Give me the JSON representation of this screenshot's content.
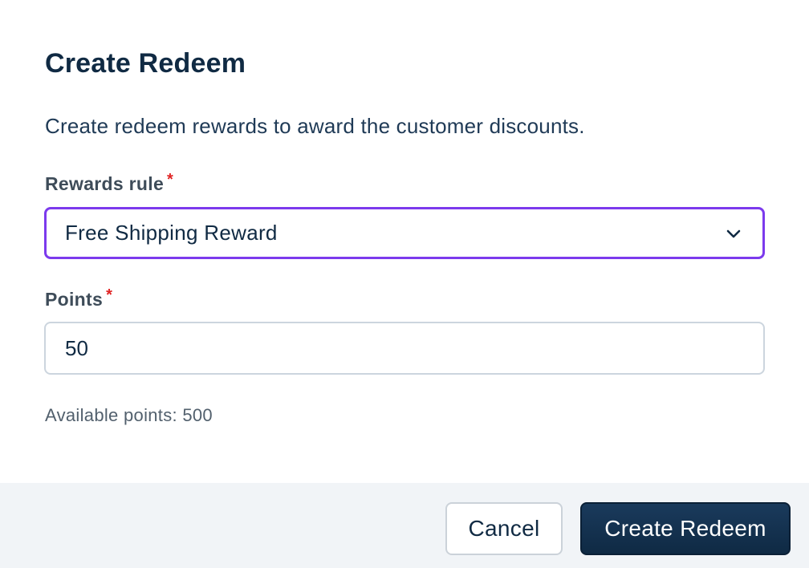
{
  "dialog": {
    "title": "Create Redeem",
    "description": "Create redeem rewards to award the customer discounts."
  },
  "form": {
    "rewards_rule": {
      "label": "Rewards rule",
      "required_mark": "*",
      "selected_value": "Free Shipping Reward"
    },
    "points": {
      "label": "Points",
      "required_mark": "*",
      "value": "50"
    },
    "available_points_text": "Available points: 500"
  },
  "footer": {
    "cancel_label": "Cancel",
    "submit_label": "Create Redeem"
  },
  "colors": {
    "focus_border": "#7c3aed",
    "primary_button": "#132f4c",
    "required": "#e02424",
    "footer_bg": "#f1f4f7"
  },
  "icons": {
    "select_chevron": "chevron-down-icon"
  }
}
